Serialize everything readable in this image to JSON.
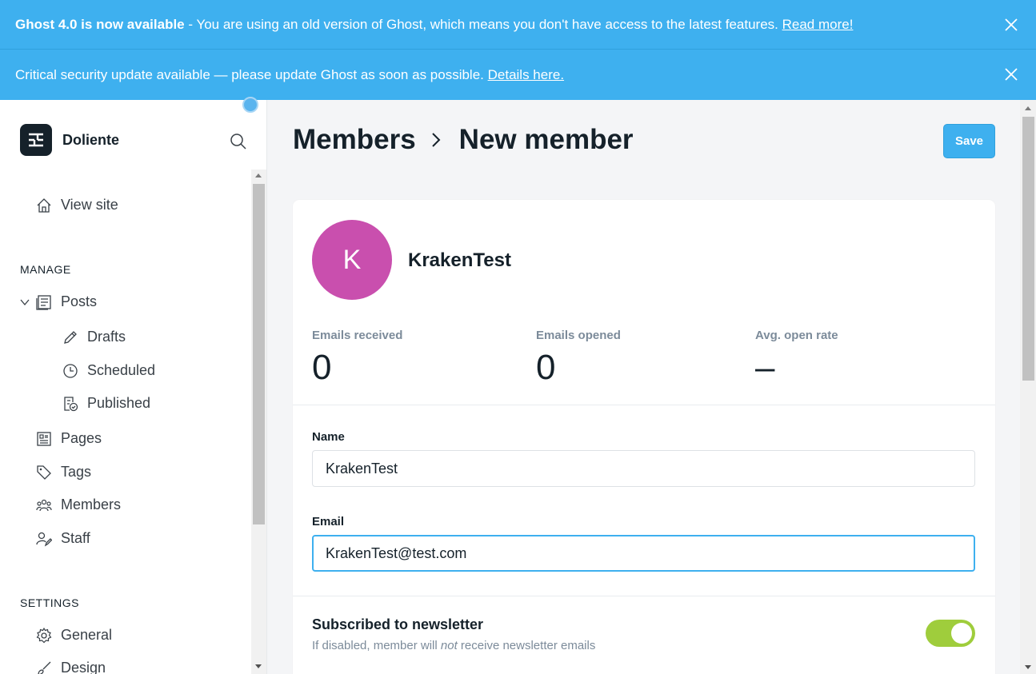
{
  "banners": [
    {
      "bold": "Ghost 4.0 is now available",
      "text": " - You are using an old version of Ghost, which means you don't have access to the latest features. ",
      "link": "Read more!"
    },
    {
      "bold": "",
      "text": "Critical security update available — please update Ghost as soon as possible. ",
      "link": "Details here."
    }
  ],
  "sidebar": {
    "site_name": "Doliente",
    "view_site": "View site",
    "manage_title": "MANAGE",
    "posts": "Posts",
    "drafts": "Drafts",
    "scheduled": "Scheduled",
    "published": "Published",
    "pages": "Pages",
    "tags": "Tags",
    "members": "Members",
    "staff": "Staff",
    "settings_title": "SETTINGS",
    "general": "General",
    "design": "Design"
  },
  "header": {
    "crumb_parent": "Members",
    "crumb_current": "New member",
    "save_label": "Save"
  },
  "member": {
    "initial": "K",
    "name": "KrakenTest",
    "stats": [
      {
        "label": "Emails received",
        "value": "0"
      },
      {
        "label": "Emails opened",
        "value": "0"
      },
      {
        "label": "Avg. open rate",
        "value": "–"
      }
    ],
    "name_label": "Name",
    "name_value": "KrakenTest",
    "email_label": "Email",
    "email_value": "KrakenTest@test.com",
    "newsletter_title": "Subscribed to newsletter",
    "newsletter_help_pre": "If disabled, member will ",
    "newsletter_help_em": "not",
    "newsletter_help_post": " receive newsletter emails",
    "newsletter_enabled": true
  },
  "colors": {
    "accent": "#3eb0ef",
    "avatar": "#c94fae",
    "toggle_on": "#9fcd3c"
  }
}
